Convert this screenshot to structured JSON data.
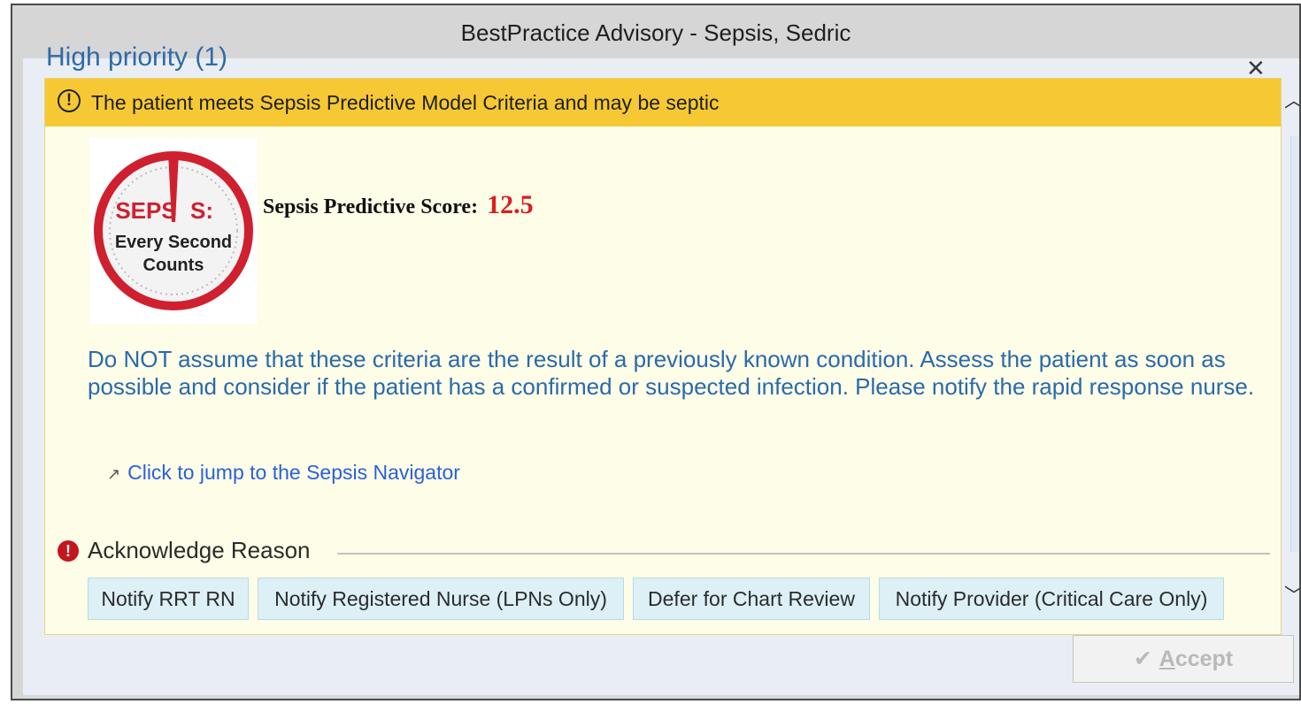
{
  "window": {
    "title": "BestPractice Advisory - Sepsis, Sedric"
  },
  "section": {
    "title": "High priority (1)",
    "close_icon": "close-icon"
  },
  "alert": {
    "header_text": "The patient meets Sepsis Predictive Model Criteria and may be septic",
    "header_color": "#f6c934",
    "background_color": "#fdfde8",
    "logo": {
      "line1_left": "SEPS",
      "line1_right": "S:",
      "line2": "Every Second",
      "line3": "Counts",
      "accent_color": "#cf202f"
    },
    "score_label": "Sepsis Predictive Score:",
    "score_value": "12.5",
    "message": "Do NOT assume that these criteria are the result of a previously known condition.  Assess the patient as soon as possible and consider if the patient has a confirmed or suspected infection.  Please notify the rapid response nurse.",
    "navigator_link": "Click to jump to the Sepsis Navigator"
  },
  "acknowledge": {
    "label": "Acknowledge Reason",
    "reasons": [
      "Notify RRT RN",
      "Notify Registered Nurse (LPNs Only)",
      "Defer for Chart Review",
      "Notify Provider (Critical Care Only)"
    ]
  },
  "footer": {
    "accept_prefix": "A",
    "accept_rest": "ccept"
  }
}
